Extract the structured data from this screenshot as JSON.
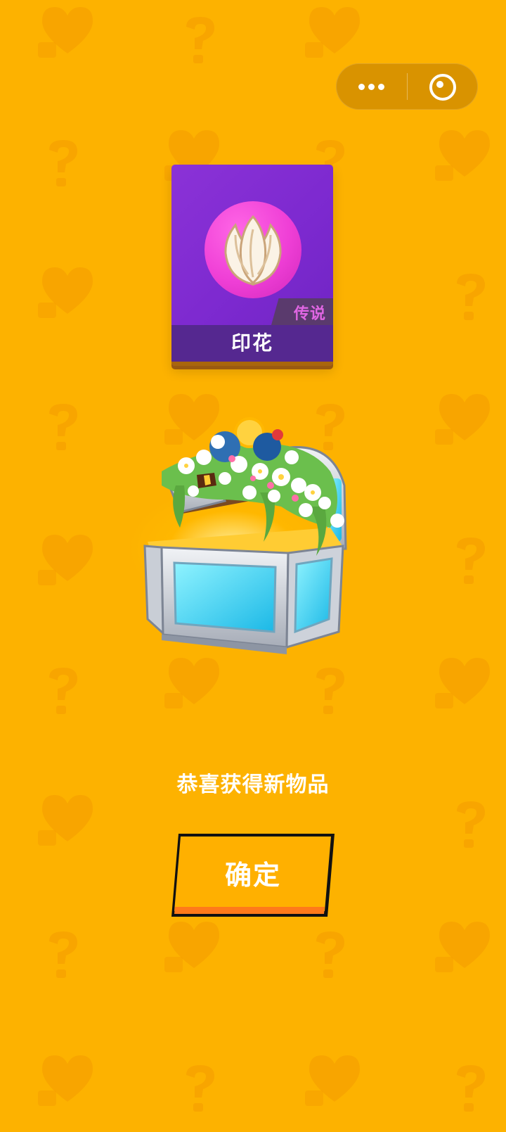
{
  "background": {
    "color": "#fdb200",
    "pattern_color": "#f39a00"
  },
  "capsule": {
    "more_icon": "more-dots-icon",
    "close_icon": "target-close-icon"
  },
  "item": {
    "name": "印花",
    "rarity": "传说",
    "icon": "flower-petals-icon",
    "card_color": "#7c29cf",
    "icon_bg_color": "#ef3fd6"
  },
  "reward": {
    "image": "flower-treasure-chest",
    "message": "恭喜获得新物品"
  },
  "actions": {
    "confirm_label": "确定"
  }
}
